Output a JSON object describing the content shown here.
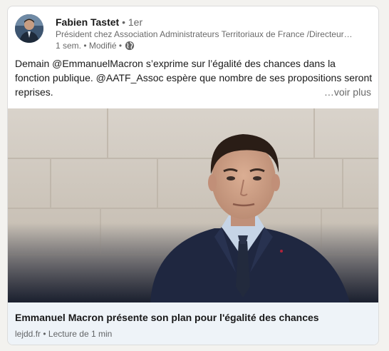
{
  "post": {
    "author": {
      "name": "Fabien Tastet",
      "degree": "• 1er",
      "headline": "Président chez Association Administrateurs Territoriaux de France /Directeur…",
      "time": "1 sem. • Modifié •"
    },
    "text": "Demain @EmmanuelMacron s’exprime sur l’égalité des chances dans la fonction publique. @AATF_Assoc espère que nombre de ses propositions seront reprises.",
    "see_more": "…voir plus"
  },
  "article": {
    "title": "Emmanuel Macron présente son plan pour l'égalité des chances",
    "source": "lejdd.fr",
    "reading": "• Lecture de 1 min"
  },
  "icons": {
    "visibility": "globe-icon"
  }
}
